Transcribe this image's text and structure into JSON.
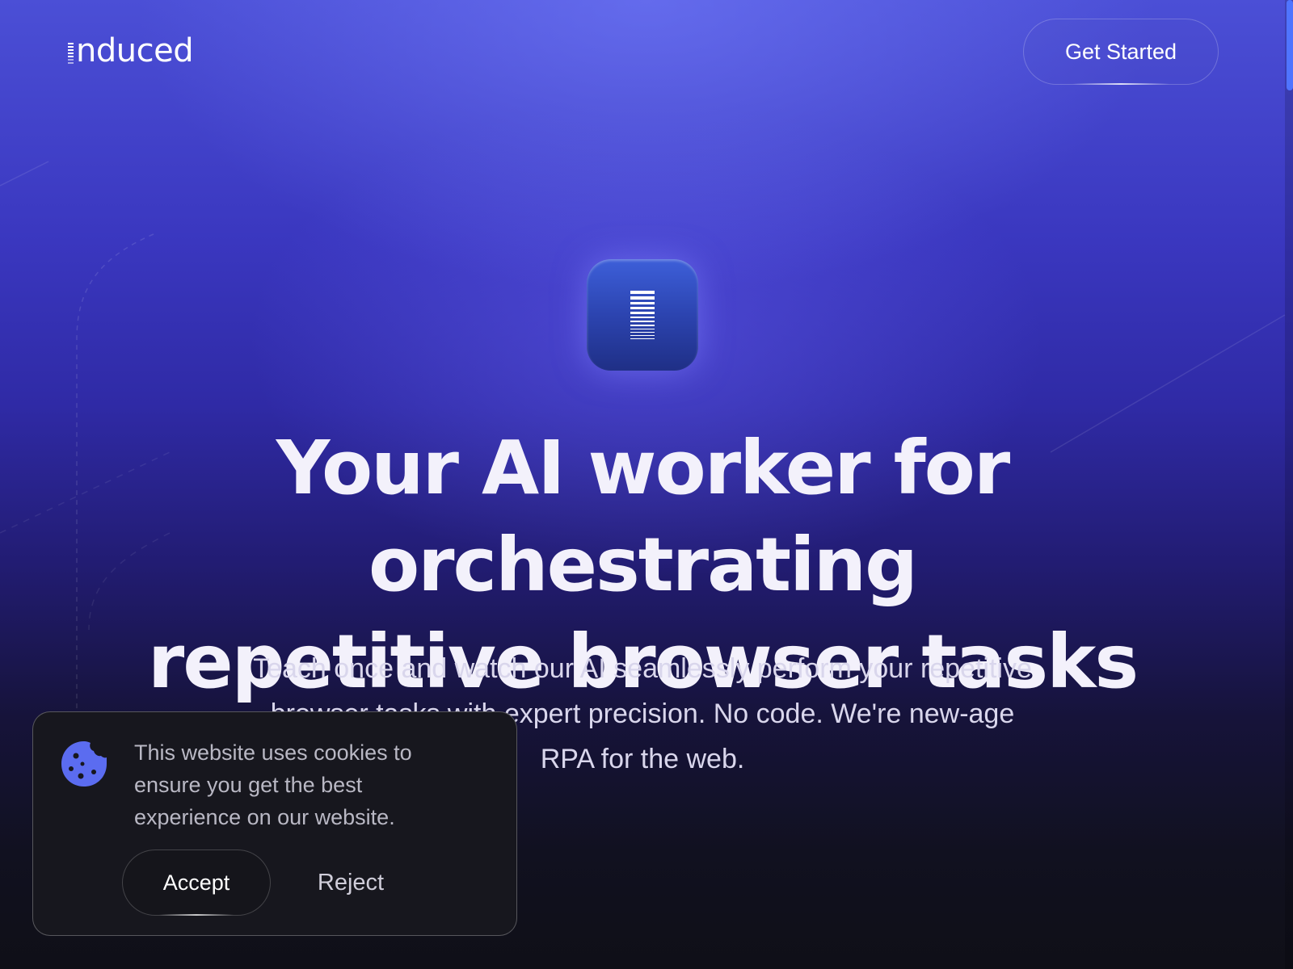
{
  "brand": {
    "name": "nduced",
    "full_name": "Induced",
    "logo_icon": "barcode-stack-icon"
  },
  "header": {
    "cta_label": "Get Started"
  },
  "hero": {
    "app_icon": "barcode-stack-icon",
    "headline_line1": "Your AI worker for orchestrating",
    "headline_line2": "repetitive browser tasks",
    "subtitle": "Teach once and watch our AI seamlessly perform your repetitive browser tasks with expert precision. No code. We're new-age RPA for the web."
  },
  "cookie_banner": {
    "icon": "cookie-icon",
    "message": "This website uses cookies to ensure you get the best experience on our website.",
    "accept_label": "Accept",
    "reject_label": "Reject"
  },
  "colors": {
    "accent": "#4f74ff",
    "cookie_icon": "#5b6cf0",
    "background_top": "#4b4fd6",
    "background_bottom": "#0f0f17",
    "banner_bg": "#17171e"
  }
}
